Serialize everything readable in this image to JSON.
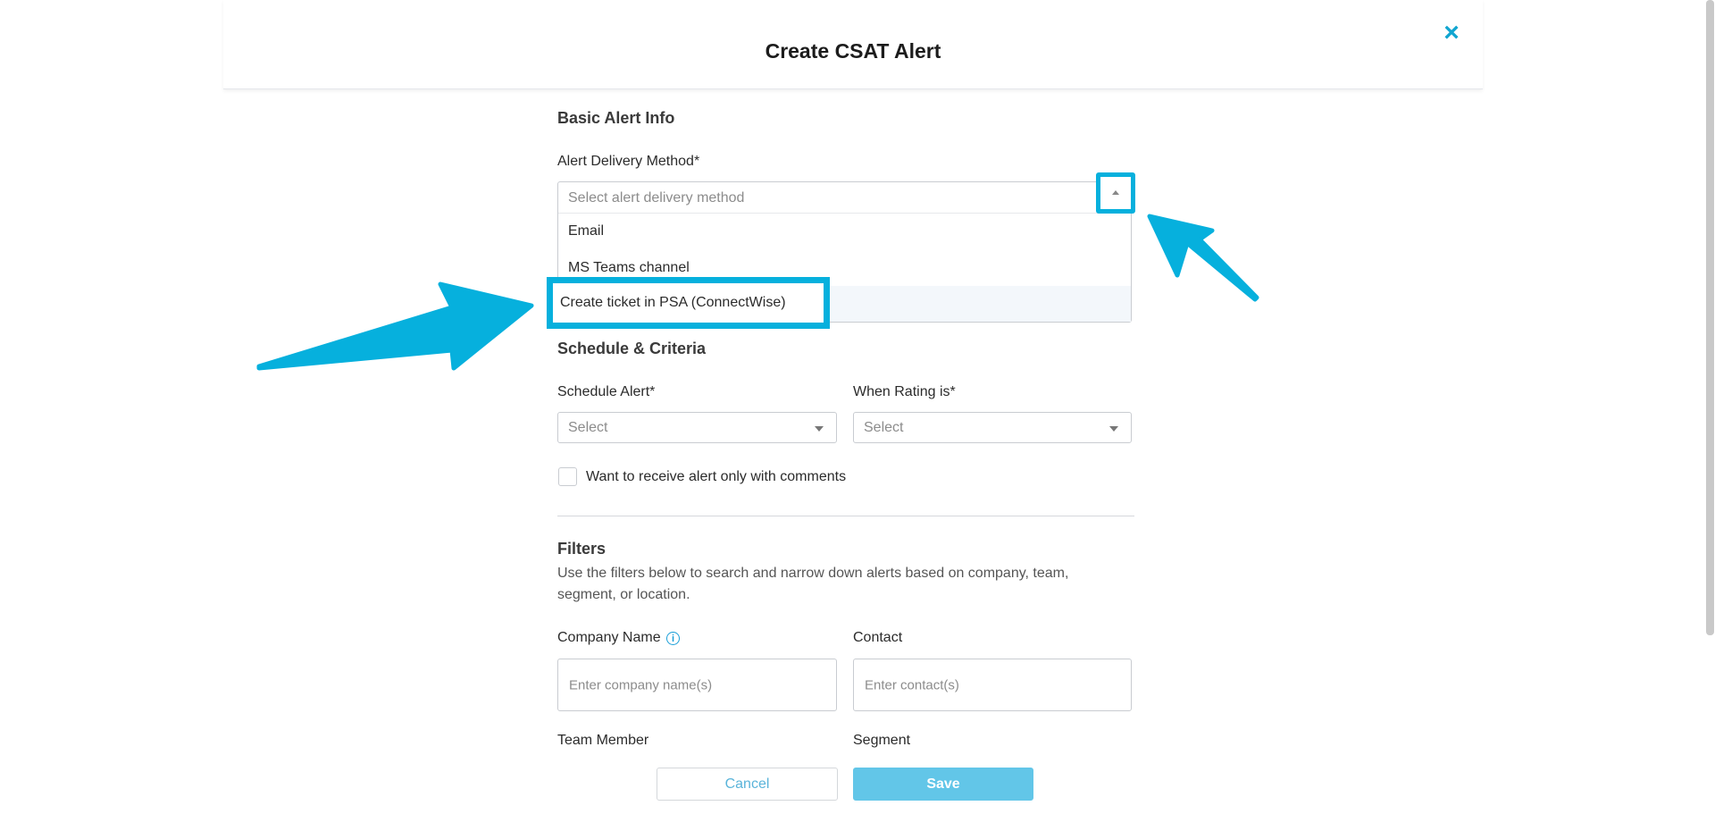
{
  "modal": {
    "title": "Create CSAT Alert",
    "close_icon": "×"
  },
  "basic_info": {
    "section_title": "Basic Alert Info",
    "delivery_label": "Alert Delivery Method*",
    "delivery_placeholder": "Select alert delivery method",
    "options": [
      "Email",
      "MS Teams channel",
      "Create ticket in PSA (ConnectWise)"
    ]
  },
  "schedule": {
    "section_title": "Schedule & Criteria",
    "schedule_label": "Schedule Alert*",
    "schedule_value": "Select",
    "rating_label": "When Rating is*",
    "rating_value": "Select",
    "comments_checkbox_label": "Want to receive alert only with comments"
  },
  "filters": {
    "section_title": "Filters",
    "description": "Use the filters below to search and narrow down alerts based on company, team, segment, or location.",
    "company_label": "Company Name",
    "company_placeholder": "Enter company name(s)",
    "contact_label": "Contact",
    "contact_placeholder": "Enter contact(s)",
    "team_member_label": "Team Member",
    "segment_label": "Segment"
  },
  "footer": {
    "cancel_label": "Cancel",
    "save_label": "Save"
  },
  "colors": {
    "accent": "#06b0dd",
    "save_bg": "#62c6e8",
    "close": "#10a5d0"
  }
}
